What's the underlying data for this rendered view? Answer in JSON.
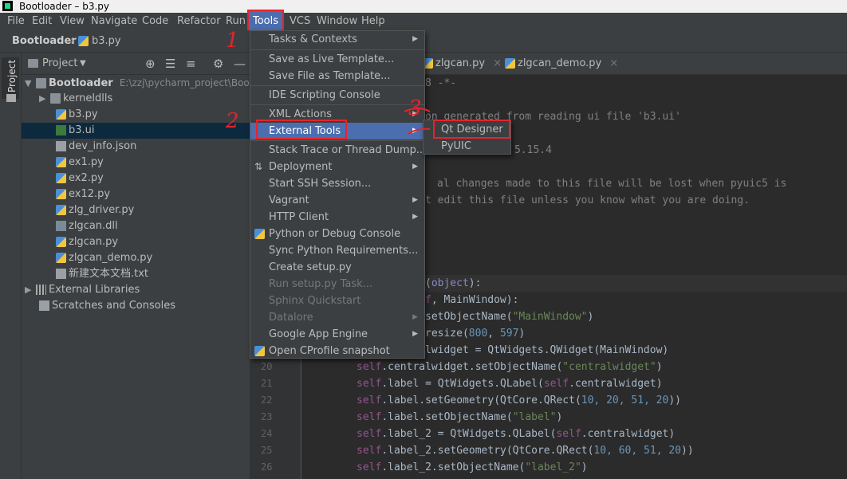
{
  "window": {
    "title": "Bootloader – b3.py"
  },
  "menubar": [
    "File",
    "Edit",
    "View",
    "Navigate",
    "Code",
    "Refactor",
    "Run",
    "Tools",
    "VCS",
    "Window",
    "Help"
  ],
  "breadcrumb": {
    "project": "Bootloader",
    "file": "b3.py"
  },
  "left_strip": {
    "label": "Project"
  },
  "project_panel": {
    "title": "Project",
    "root": {
      "name": "Bootloader",
      "path": "E:\\zzj\\pycharm_project\\Bootlo"
    },
    "items": [
      {
        "label": "kerneldlls",
        "type": "folder"
      },
      {
        "label": "b3.py",
        "type": "py"
      },
      {
        "label": "b3.ui",
        "type": "ui"
      },
      {
        "label": "dev_info.json",
        "type": "file"
      },
      {
        "label": "ex1.py",
        "type": "py"
      },
      {
        "label": "ex2.py",
        "type": "py"
      },
      {
        "label": "ex12.py",
        "type": "py"
      },
      {
        "label": "zlg_driver.py",
        "type": "py"
      },
      {
        "label": "zlgcan.dll",
        "type": "dll"
      },
      {
        "label": "zlgcan.py",
        "type": "py"
      },
      {
        "label": "zlgcan_demo.py",
        "type": "py"
      },
      {
        "label": "新建文本文档.txt",
        "type": "file"
      }
    ],
    "external_libraries": "External Libraries",
    "scratches": "Scratches and Consoles"
  },
  "editor_tabs": [
    {
      "label": "zlgcan.py"
    },
    {
      "label": "zlgcan_demo.py"
    }
  ],
  "code_snippets": {
    "l1": "8 -*-",
    "l2": "on generated from reading ui file 'b3.ui'",
    "l3": "rator 5.15.4",
    "l4": "al changes made to this file will be lost when pyuic5 is",
    "l5": "t edit this file unless you know what you are doing.",
    "l6a": "(",
    "l6b": "object",
    "l6c": "):",
    "l7a": "f",
    "l7b": ", MainWindow):",
    "l8a": "setObjectName(",
    "l8b": "\"MainWindow\"",
    "l8c": ")",
    "l9a": "resize(",
    "l9b": "800",
    "l9c": ", ",
    "l9d": "597",
    "l9e": ")",
    "l10": "lwidget = QtWidgets.QWidget(MainWindow)"
  },
  "code_lines": [
    {
      "n": "20",
      "self": "self",
      "a": ".centralwidget.setObjectName(",
      "s": "\"centralwidget\"",
      "b": ")"
    },
    {
      "n": "21",
      "self": "self",
      "a": ".label = QtWidgets.QLabel(",
      "self2": "self",
      "b": ".centralwidget)"
    },
    {
      "n": "22",
      "self": "self",
      "a": ".label.setGeometry(QtCore.QRect(",
      "nums": "10, 20, 51, 20",
      "b": "))"
    },
    {
      "n": "23",
      "self": "self",
      "a": ".label.setObjectName(",
      "s": "\"label\"",
      "b": ")"
    },
    {
      "n": "24",
      "self": "self",
      "a": ".label_2 = QtWidgets.QLabel(",
      "self2": "self",
      "b": ".centralwidget)"
    },
    {
      "n": "25",
      "self": "self",
      "a": ".label_2.setGeometry(QtCore.QRect(",
      "nums": "10, 60, 51, 20",
      "b": "))"
    },
    {
      "n": "26",
      "self": "self",
      "a": ".label_2.setObjectName(",
      "s": "\"label_2\"",
      "b": ")"
    }
  ],
  "tools_menu": {
    "items": [
      {
        "label": "Tasks & Contexts",
        "submenu": true
      },
      {
        "label": "Save as Live Template..."
      },
      {
        "label": "Save File as Template..."
      },
      {
        "label": "IDE Scripting Console"
      },
      {
        "label": "XML Actions",
        "submenu": true
      },
      {
        "label": "External Tools",
        "submenu": true,
        "highlighted": true
      },
      {
        "label": "Stack Trace or Thread Dump..."
      },
      {
        "label": "Deployment",
        "submenu": true
      },
      {
        "label": "Start SSH Session..."
      },
      {
        "label": "Vagrant",
        "submenu": true
      },
      {
        "label": "HTTP Client",
        "submenu": true
      },
      {
        "label": "Python or Debug Console"
      },
      {
        "label": "Sync Python Requirements..."
      },
      {
        "label": "Create setup.py"
      },
      {
        "label": "Run setup.py Task...",
        "disabled": true
      },
      {
        "label": "Sphinx Quickstart",
        "disabled": true
      },
      {
        "label": "Datalore",
        "submenu": true,
        "disabled": true
      },
      {
        "label": "Google App Engine",
        "submenu": true
      },
      {
        "label": "Open CProfile snapshot"
      }
    ]
  },
  "external_tools_submenu": [
    "Qt Designer",
    "PyUIC"
  ],
  "annotations": [
    "1",
    "2",
    "3"
  ],
  "colors": {
    "accent": "#4b6eaf",
    "annotation_red": "#e5242b",
    "selection": "#0d293e"
  }
}
